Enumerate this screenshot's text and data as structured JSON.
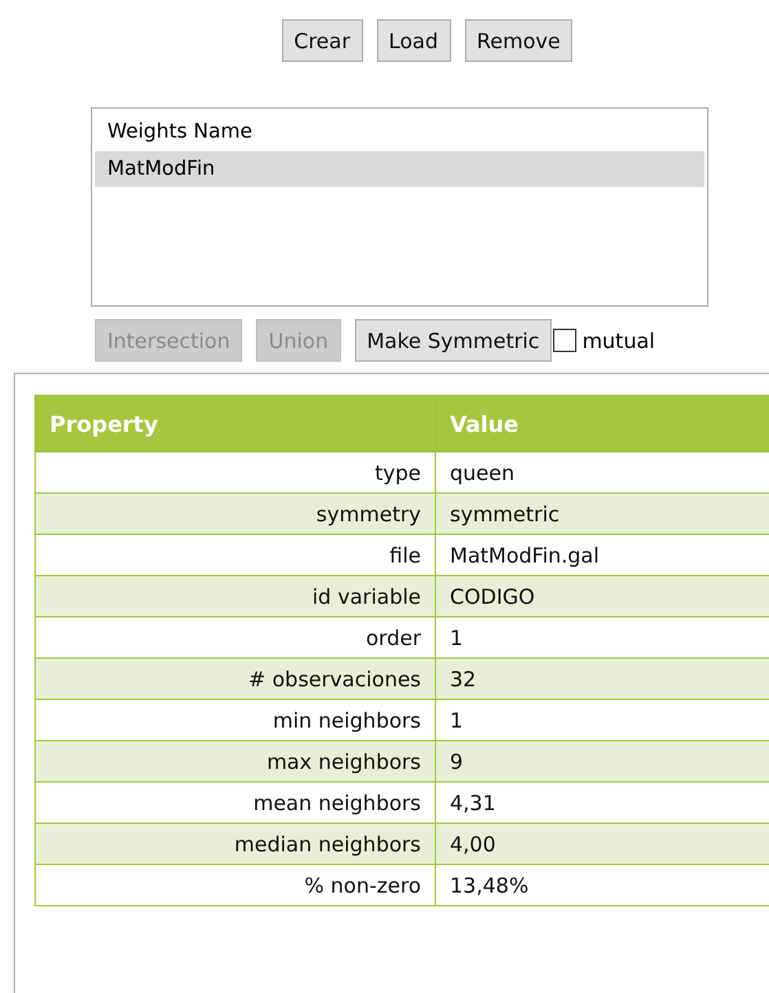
{
  "top_buttons": [
    {
      "label": "Crear",
      "disabled": false
    },
    {
      "label": "Load",
      "disabled": false
    },
    {
      "label": "Remove",
      "disabled": false
    }
  ],
  "weights_list": {
    "header": "Weights Name",
    "items": [
      {
        "label": "MatModFin",
        "selected": true
      }
    ]
  },
  "action_buttons": [
    {
      "label": "Intersection",
      "disabled": true
    },
    {
      "label": "Union",
      "disabled": true
    },
    {
      "label": "Make Symmetric",
      "disabled": false
    }
  ],
  "mutual": {
    "label": "mutual",
    "checked": false
  },
  "table": {
    "columns": [
      "Property",
      "Value"
    ],
    "rows": [
      [
        "type",
        "queen"
      ],
      [
        "symmetry",
        "symmetric"
      ],
      [
        "file",
        "MatModFin.gal"
      ],
      [
        "id variable",
        "CODIGO"
      ],
      [
        "order",
        "1"
      ],
      [
        "# observaciones",
        "32"
      ],
      [
        "min neighbors",
        "1"
      ],
      [
        "max neighbors",
        "9"
      ],
      [
        "mean neighbors",
        "4,31"
      ],
      [
        "median neighbors",
        "4,00"
      ],
      [
        "% non-zero",
        "13,48%"
      ]
    ]
  }
}
